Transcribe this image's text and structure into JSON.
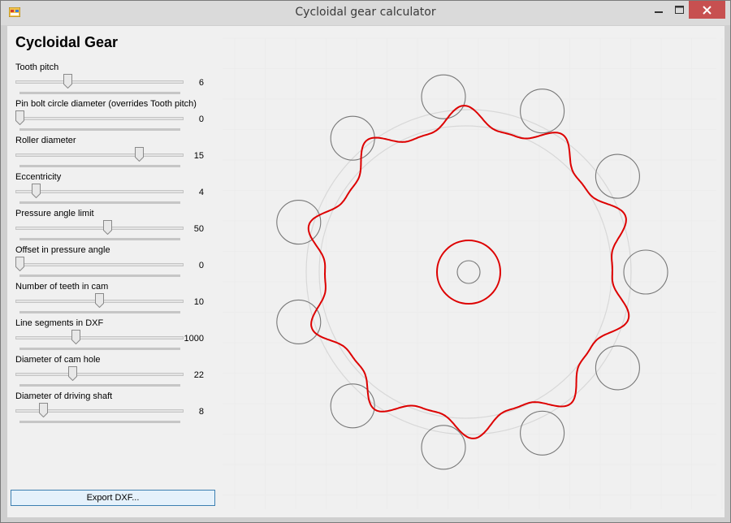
{
  "window": {
    "title": "Cycloidal gear calculator",
    "app_icon": "app-icon",
    "controls": [
      "minimize-icon",
      "maximize-icon",
      "close-icon"
    ],
    "close_color": "#c75050"
  },
  "panel": {
    "heading": "Cycloidal Gear",
    "params": [
      {
        "label": "Tooth pitch",
        "value": "6",
        "position": 0.3
      },
      {
        "label": "Pin bolt circle diameter (overrides Tooth pitch)",
        "value": "0",
        "position": 0.0
      },
      {
        "label": "Roller diameter",
        "value": "15",
        "position": 0.75
      },
      {
        "label": "Eccentricity",
        "value": "4",
        "position": 0.1
      },
      {
        "label": "Pressure angle limit",
        "value": "50",
        "position": 0.55
      },
      {
        "label": "Offset in pressure angle",
        "value": "0",
        "position": 0.0
      },
      {
        "label": "Number of teeth in cam",
        "value": "10",
        "position": 0.5
      },
      {
        "label": "Line segments in DXF",
        "value": "1000",
        "position": 0.35
      },
      {
        "label": "Diameter of cam hole",
        "value": "22",
        "position": 0.33
      },
      {
        "label": "Diameter of driving shaft",
        "value": "8",
        "position": 0.15
      }
    ],
    "export_label": "Export DXF..."
  },
  "drawing": {
    "cam_color": "#dd0000",
    "guide_color": "#d8d8d8",
    "roller_color": "#777777",
    "grid_color": "#ececec",
    "roller_count": 11,
    "lobe_count": 10
  }
}
